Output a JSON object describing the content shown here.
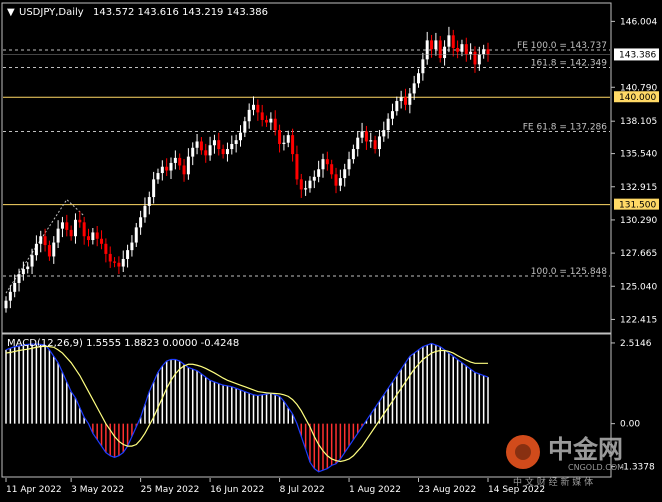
{
  "window": {
    "symbol_title": "USDJPY,Daily",
    "ohlc": "143.572 143.616 143.219 143.386"
  },
  "colors": {
    "background": "#000000",
    "bull": "#ffffff",
    "bear": "#ff0000",
    "grid": "#c0c0c0",
    "level_line": "#ffd966",
    "price_tag_bg": "#ffffff",
    "macd_main": "#1e3cff",
    "macd_signal": "#ffff80",
    "histogram_pos": "#ffffff",
    "histogram_neg": "#ff3030",
    "axis_text": "#ffffff"
  },
  "chart_data": {
    "type": "candlestick",
    "price_axis_ticks": [
      "146.004",
      "143.386",
      "140.790",
      "140.000",
      "138.105",
      "135.540",
      "132.915",
      "131.500",
      "130.290",
      "127.665",
      "125.040",
      "122.415"
    ],
    "price_tick_values": [
      146.004,
      140.79,
      138.105,
      135.54,
      132.915,
      130.29,
      127.665,
      125.04,
      122.415
    ],
    "price_range": [
      121.5,
      147.3
    ],
    "current_price": "143.386",
    "current_price_value": 143.386,
    "horizontal_levels": [
      {
        "value": 140.0,
        "label": "140.000"
      },
      {
        "value": 131.5,
        "label": "131.500"
      }
    ],
    "fib_levels": [
      {
        "value": 143.737,
        "label": "FE 100.0 = 143.737"
      },
      {
        "value": 142.349,
        "label": "161.8 = 142.349"
      },
      {
        "value": 137.286,
        "label": "FE 61.8 = 137.286"
      },
      {
        "value": 125.848,
        "label": "100.0 = 125.848"
      }
    ],
    "x_axis_labels": [
      "11 Apr 2022",
      "3 May 2022",
      "25 May 2022",
      "16 Jun 2022",
      "8 Jul 2022",
      "1 Aug 2022",
      "23 Aug 2022",
      "14 Sep 2022"
    ],
    "x_label_bar_index": [
      0,
      15,
      31,
      47,
      63,
      79,
      95,
      111
    ],
    "closes": [
      123.9,
      124.6,
      125.3,
      126.0,
      126.4,
      126.6,
      127.5,
      128.4,
      129.0,
      128.3,
      127.4,
      128.5,
      129.6,
      130.1,
      129.5,
      129.0,
      130.3,
      130.1,
      129.0,
      128.7,
      129.3,
      128.8,
      128.4,
      127.6,
      127.0,
      126.9,
      126.6,
      127.2,
      127.9,
      128.5,
      129.7,
      130.5,
      131.4,
      132.1,
      133.5,
      134.0,
      134.5,
      134.2,
      134.8,
      135.2,
      134.6,
      133.9,
      135.3,
      136.0,
      136.5,
      135.8,
      135.4,
      136.2,
      136.6,
      135.9,
      135.5,
      135.9,
      136.3,
      136.6,
      137.2,
      138.1,
      139.0,
      139.4,
      138.8,
      138.2,
      138.0,
      138.3,
      137.4,
      136.3,
      136.4,
      137.0,
      135.5,
      133.5,
      132.7,
      132.8,
      133.4,
      133.7,
      134.3,
      135.1,
      134.7,
      133.9,
      133.0,
      133.6,
      134.3,
      135.1,
      135.9,
      136.8,
      137.3,
      136.5,
      136.6,
      135.9,
      136.9,
      137.4,
      138.3,
      138.9,
      139.7,
      140.0,
      139.4,
      140.3,
      141.1,
      141.9,
      143.0,
      144.5,
      143.8,
      144.5,
      143.1,
      144.0,
      144.9,
      143.9,
      143.6,
      144.2,
      143.4,
      143.6,
      142.6,
      143.4,
      143.8,
      143.4
    ]
  },
  "macd": {
    "label": "MACD(12,26,9) 1.5555 1.8823 0.0000 -0.4248",
    "ticks": [
      "2.5146",
      "0.00",
      "-1.3378"
    ],
    "range": [
      -1.6,
      2.7
    ],
    "main": [
      2.3,
      2.35,
      2.4,
      2.42,
      2.45,
      2.47,
      2.48,
      2.48,
      2.47,
      2.45,
      2.3,
      2.1,
      1.9,
      1.6,
      1.3,
      1.0,
      0.8,
      0.5,
      0.2,
      0.0,
      -0.3,
      -0.5,
      -0.7,
      -0.9,
      -1.0,
      -1.05,
      -1.0,
      -0.9,
      -0.7,
      -0.4,
      -0.1,
      0.2,
      0.6,
      1.0,
      1.3,
      1.6,
      1.8,
      1.95,
      2.0,
      2.0,
      1.95,
      1.85,
      1.75,
      1.7,
      1.65,
      1.55,
      1.45,
      1.35,
      1.3,
      1.25,
      1.2,
      1.18,
      1.15,
      1.1,
      1.05,
      1.0,
      0.95,
      0.9,
      0.88,
      0.9,
      0.92,
      0.95,
      0.9,
      0.85,
      0.7,
      0.5,
      0.3,
      0.0,
      -0.4,
      -0.8,
      -1.2,
      -1.4,
      -1.5,
      -1.45,
      -1.4,
      -1.3,
      -1.25,
      -1.1,
      -0.9,
      -0.7,
      -0.5,
      -0.3,
      -0.1,
      0.1,
      0.3,
      0.5,
      0.7,
      0.9,
      1.1,
      1.3,
      1.5,
      1.7,
      1.9,
      2.1,
      2.2,
      2.3,
      2.4,
      2.45,
      2.5,
      2.45,
      2.4,
      2.3,
      2.2,
      2.1,
      2.0,
      1.9,
      1.8,
      1.7,
      1.6,
      1.55,
      1.5,
      1.45
    ],
    "signal": [
      2.2,
      2.22,
      2.25,
      2.28,
      2.3,
      2.32,
      2.35,
      2.38,
      2.4,
      2.41,
      2.4,
      2.38,
      2.3,
      2.2,
      2.05,
      1.9,
      1.7,
      1.5,
      1.25,
      1.0,
      0.75,
      0.5,
      0.25,
      0.0,
      -0.2,
      -0.4,
      -0.55,
      -0.65,
      -0.7,
      -0.7,
      -0.65,
      -0.5,
      -0.3,
      -0.05,
      0.2,
      0.5,
      0.8,
      1.1,
      1.35,
      1.55,
      1.7,
      1.8,
      1.85,
      1.85,
      1.82,
      1.78,
      1.72,
      1.65,
      1.58,
      1.5,
      1.42,
      1.35,
      1.3,
      1.25,
      1.2,
      1.15,
      1.1,
      1.05,
      1.0,
      0.98,
      0.96,
      0.95,
      0.94,
      0.93,
      0.9,
      0.85,
      0.75,
      0.6,
      0.4,
      0.15,
      -0.1,
      -0.4,
      -0.65,
      -0.85,
      -1.0,
      -1.1,
      -1.15,
      -1.18,
      -1.15,
      -1.1,
      -1.0,
      -0.85,
      -0.7,
      -0.5,
      -0.3,
      -0.1,
      0.1,
      0.3,
      0.5,
      0.7,
      0.9,
      1.1,
      1.3,
      1.5,
      1.7,
      1.85,
      2.0,
      2.1,
      2.2,
      2.25,
      2.28,
      2.28,
      2.25,
      2.2,
      2.12,
      2.05,
      1.98,
      1.92,
      1.88,
      1.88,
      1.88,
      1.88
    ]
  },
  "watermark": {
    "brand": "中金网",
    "domain": "CNGOLD.COM",
    "tagline": "中 文 财 经 新 媒 体"
  }
}
